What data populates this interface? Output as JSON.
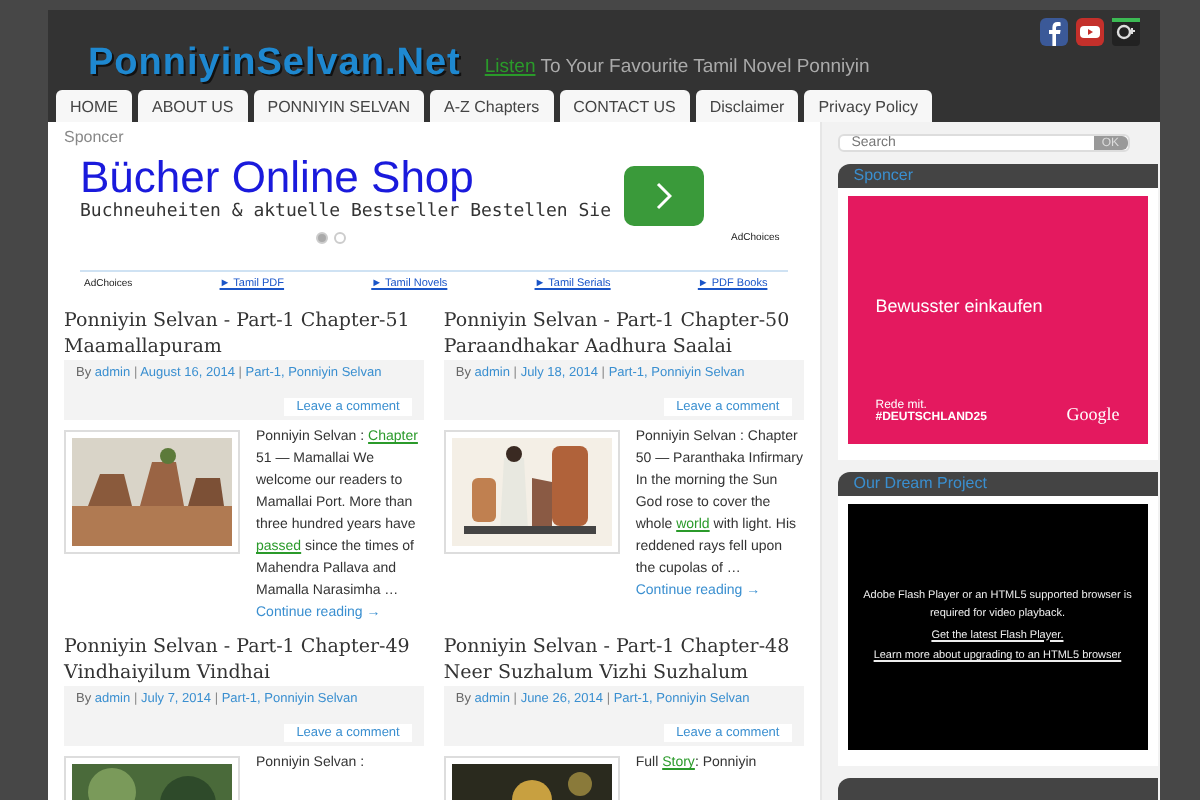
{
  "header": {
    "logo": "PonniyinSelvan.Net",
    "tagline_link": "Listen",
    "tagline": "To Your Favourite Tamil Novel Ponniyin",
    "social": [
      {
        "kind": "facebook"
      },
      {
        "kind": "youtube"
      },
      {
        "kind": "googleplus"
      }
    ]
  },
  "nav": [
    "HOME",
    "ABOUT US",
    "PONNIYIN SELVAN",
    "A-Z Chapters",
    "CONTACT US",
    "Disclaimer",
    "Privacy Policy"
  ],
  "sponsor": {
    "label": "Sponcer",
    "ad": {
      "title": "Bücher Online Shop",
      "text": "Buchneuheiten & aktuelle Bestseller Bestellen Sie",
      "slides": [
        {
          "selected": true
        },
        {
          "selected": false
        }
      ],
      "adchoices": "AdChoices"
    }
  },
  "link_bar": {
    "adchoices": "AdChoices",
    "links": [
      "► Tamil PDF",
      "► Tamil Novels",
      "► Tamil Serials",
      "► PDF Books"
    ]
  },
  "meta_separator": "|",
  "posts": [
    {
      "title": "Ponniyin Selvan - Part-1 Chapter-51 Maamallapuram",
      "by": "By",
      "author": "admin",
      "date": "August 16, 2014",
      "category": "Part-1, Ponniyin Selvan",
      "comment": "Leave a comment",
      "picture": {
        "kind": "picture"
      },
      "excerpt": [
        {
          "text": "Ponniyin Selvan : "
        },
        {
          "text": "Chapter",
          "link": true
        },
        {
          "text": " 51 — Mamallai  We welcome our readers to Mamallai Port. More than three hundred years have "
        },
        {
          "text": "passed",
          "link": true
        },
        {
          "text": " since the times of Mahendra Pallava and Mamalla Narasimha … "
        }
      ],
      "more": "Continue reading →"
    },
    {
      "title": "Ponniyin Selvan - Part-1 Chapter-50 Paraandhakar Aadhura Saalai",
      "by": "By",
      "author": "admin",
      "date": "July 18, 2014",
      "category": "Part-1, Ponniyin Selvan",
      "comment": "Leave a comment",
      "picture": {
        "kind": "picture"
      },
      "excerpt": [
        {
          "text": "Ponniyin Selvan : Chapter 50 — Paranthaka Infirmary In the morning the Sun God rose to cover the whole "
        },
        {
          "text": "world",
          "link": true
        },
        {
          "text": " with light. His reddened rays fell upon the cupolas of … "
        }
      ],
      "more": "Continue reading →"
    },
    {
      "title": "Ponniyin Selvan - Part-1 Chapter-49 Vindhaiyilum Vindhai",
      "by": "By",
      "author": "admin",
      "date": "July 7, 2014",
      "category": "Part-1, Ponniyin Selvan",
      "comment": "Leave a comment",
      "picture": {
        "kind": "picture"
      },
      "excerpt": [
        {
          "text": "Ponniyin Selvan :"
        }
      ]
    },
    {
      "title": "Ponniyin Selvan - Part-1 Chapter-48 Neer Suzhalum Vizhi Suzhalum",
      "by": "By",
      "author": "admin",
      "date": "June 26, 2014",
      "category": "Part-1, Ponniyin Selvan",
      "comment": "Leave a comment",
      "picture": {
        "kind": "picture"
      },
      "excerpt": [
        {
          "text": "Full "
        },
        {
          "text": "Story",
          "link": true
        },
        {
          "text": ": Ponniyin"
        }
      ]
    }
  ],
  "sidebar": {
    "search": {
      "placeholder": "Search",
      "button": "OK"
    },
    "widgets": [
      {
        "kind": "ad",
        "title": "Sponcer",
        "headline": "Bewusster einkaufen",
        "line": "Rede mit.",
        "hashtag": "#DEUTSCHLAND25",
        "brand": "Google"
      },
      {
        "kind": "video",
        "title": "Our Dream Project",
        "message": "Adobe Flash Player or an HTML5 supported browser is required for video playback.",
        "links": [
          "Get the latest Flash Player.",
          "Learn more about upgrading to an HTML5 browser"
        ]
      },
      {
        "kind": "empty"
      }
    ]
  }
}
